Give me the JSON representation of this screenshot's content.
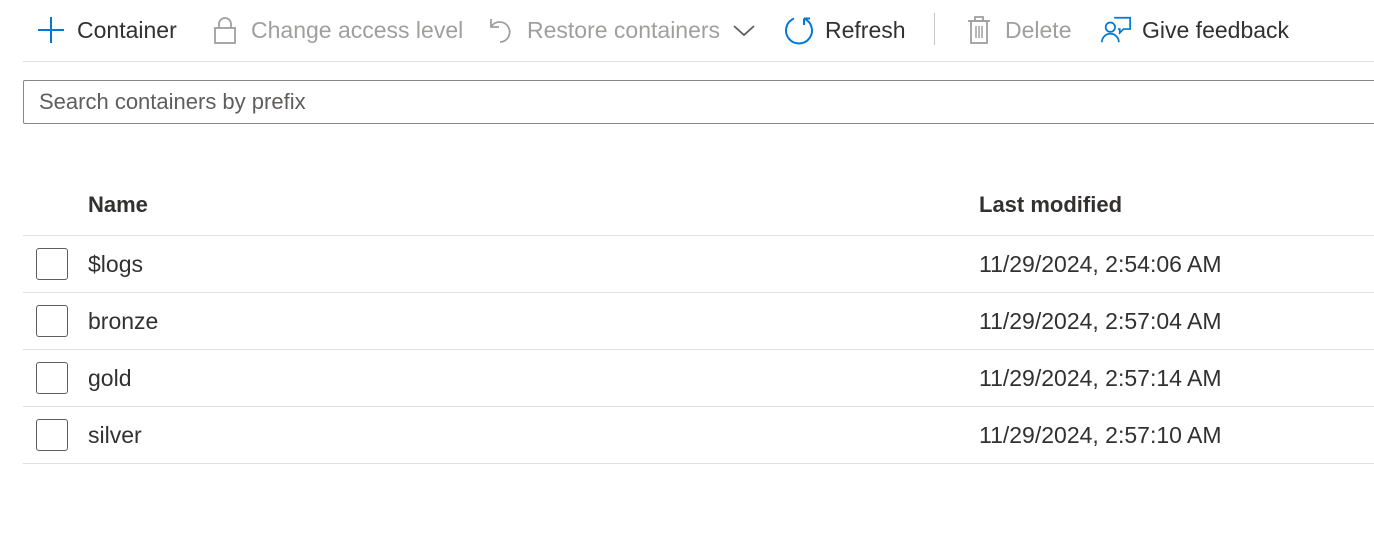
{
  "toolbar": {
    "add_container": {
      "label": "Container",
      "icon": "plus-icon",
      "enabled": true
    },
    "change_access": {
      "label": "Change access level",
      "icon": "lock-icon",
      "enabled": false
    },
    "restore": {
      "label": "Restore containers",
      "icon": "undo-icon",
      "enabled": false
    },
    "refresh": {
      "label": "Refresh",
      "icon": "refresh-icon",
      "enabled": true
    },
    "delete": {
      "label": "Delete",
      "icon": "trash-icon",
      "enabled": false
    },
    "feedback": {
      "label": "Give feedback",
      "icon": "feedback-icon",
      "enabled": true
    }
  },
  "search": {
    "placeholder": "Search containers by prefix",
    "value": ""
  },
  "table": {
    "columns": {
      "name": "Name",
      "last_modified": "Last modified"
    },
    "rows": [
      {
        "name": "$logs",
        "last_modified": "11/29/2024, 2:54:06 AM",
        "checked": false
      },
      {
        "name": "bronze",
        "last_modified": "11/29/2024, 2:57:04 AM",
        "checked": false
      },
      {
        "name": "gold",
        "last_modified": "11/29/2024, 2:57:14 AM",
        "checked": false
      },
      {
        "name": "silver",
        "last_modified": "11/29/2024, 2:57:10 AM",
        "checked": false
      }
    ]
  },
  "colors": {
    "accent": "#0078d4",
    "text": "#323130",
    "disabled": "#a19f9d",
    "divider": "#e1dfdd"
  }
}
